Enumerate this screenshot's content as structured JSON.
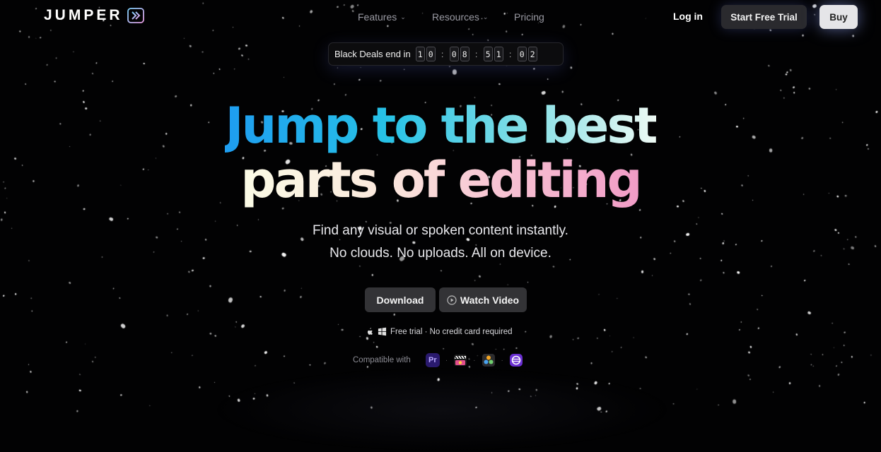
{
  "brand": {
    "name": "JUMPER",
    "logo_icon": "chevron-double-icon"
  },
  "nav": {
    "features": "Features",
    "resources": "Resources",
    "pricing": "Pricing",
    "login": "Log in",
    "start_trial": "Start Free Trial",
    "buy": "Buy"
  },
  "countdown": {
    "label": "Black Deals end in",
    "groups": [
      [
        "1",
        "0"
      ],
      [
        "0",
        "8"
      ],
      [
        "5",
        "1"
      ],
      [
        "0",
        "2"
      ]
    ]
  },
  "hero": {
    "headline_line1": "Jump to the best",
    "headline_line2": "parts of editing",
    "sub_line1": "Find any visual or spoken content instantly.",
    "sub_line2": "No clouds. No uploads. All on device."
  },
  "actions": {
    "download": "Download",
    "watch_video": "Watch Video"
  },
  "trial_note": "Free trial · No credit card required",
  "compatible": {
    "label": "Compatible with",
    "apps": [
      {
        "name": "Premiere Pro",
        "icon": "premiere-pro-icon",
        "text": "Pr"
      },
      {
        "name": "Final Cut Pro",
        "icon": "final-cut-pro-icon"
      },
      {
        "name": "DaVinci Resolve",
        "icon": "davinci-resolve-icon"
      },
      {
        "name": "Avid",
        "icon": "avid-icon"
      }
    ]
  },
  "colors": {
    "background": "#020203",
    "headline_gradient_1": [
      "#1e9df0",
      "#eefaf4"
    ],
    "headline_gradient_2": [
      "#fbfbe6",
      "#f19bc6"
    ],
    "button": "#333336",
    "buy_button": "#e5e5e8"
  }
}
